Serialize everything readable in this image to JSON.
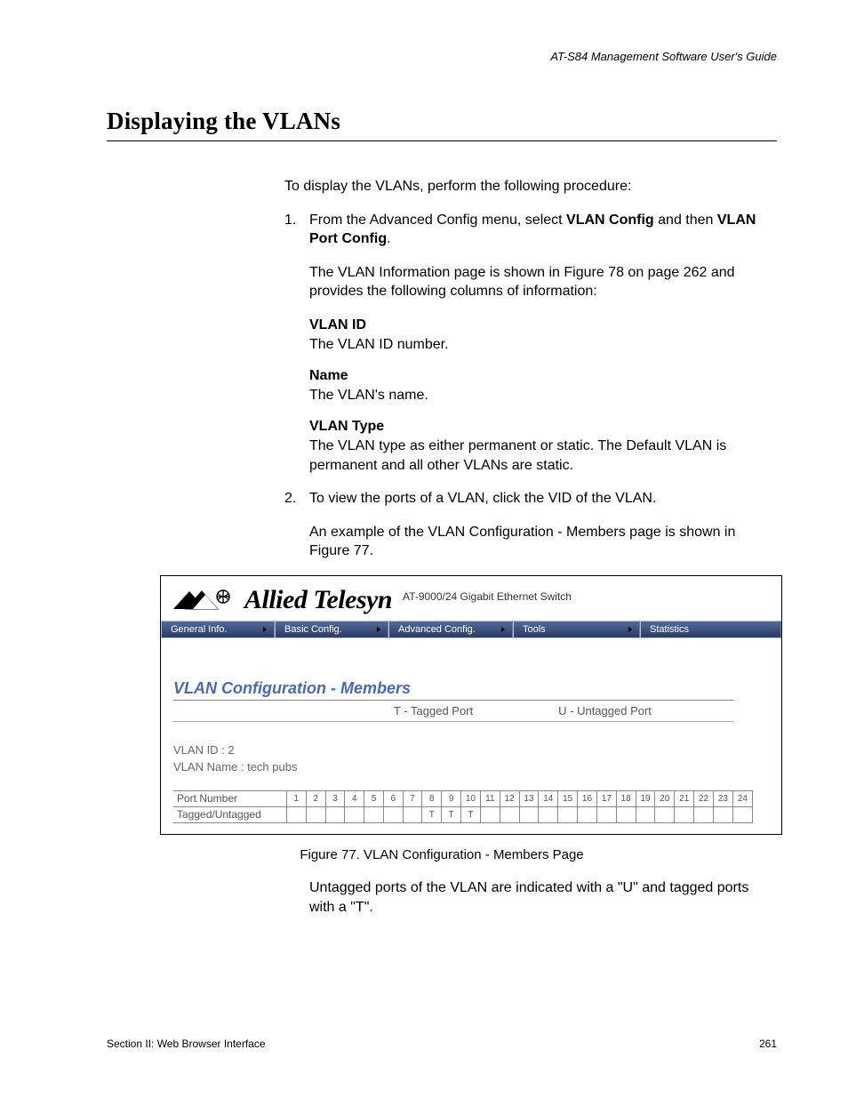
{
  "header": {
    "guide": "AT-S84 Management Software User's Guide"
  },
  "title": "Displaying the VLANs",
  "intro": "To display the VLANs, perform the following procedure:",
  "steps": {
    "s1num": "1.",
    "s1a": "From the Advanced Config menu, select ",
    "s1b": "VLAN Config",
    "s1c": " and then ",
    "s1d": "VLAN Port Config",
    "s1e": ".",
    "s1follow": "The VLAN Information page is shown in Figure 78 on page 262 and provides the following columns of information:",
    "defs": {
      "t1": "VLAN ID",
      "d1": "The VLAN ID number.",
      "t2": "Name",
      "d2": "The VLAN's name.",
      "t3": "VLAN Type",
      "d3": "The VLAN type as either permanent or static. The Default VLAN is permanent and all other VLANs are static."
    },
    "s2num": "2.",
    "s2": "To view the ports of a VLAN, click the VID of the VLAN.",
    "s2follow": "An example of the VLAN Configuration - Members page is shown in Figure 77."
  },
  "screenshot": {
    "brand": "Allied Telesyn",
    "model": "AT-9000/24 Gigabit Ethernet Switch",
    "menu": {
      "m1": "General Info.",
      "m2": "Basic Config.",
      "m3": "Advanced Config.",
      "m4": "Tools",
      "m5": "Statistics"
    },
    "page_title": "VLAN Configuration - Members",
    "legend_t": "T - Tagged Port",
    "legend_u": "U - Untagged Port",
    "vlan_id_label": "VLAN ID : 2",
    "vlan_name_label": "VLAN Name : tech pubs",
    "row_port_label": "Port Number",
    "row_tag_label": "Tagged/Untagged",
    "ports": [
      "1",
      "2",
      "3",
      "4",
      "5",
      "6",
      "7",
      "8",
      "9",
      "10",
      "11",
      "12",
      "13",
      "14",
      "15",
      "16",
      "17",
      "18",
      "19",
      "20",
      "21",
      "22",
      "23",
      "24"
    ],
    "tags": [
      "",
      "",
      "",
      "",
      "",
      "",
      "",
      "T",
      "T",
      "T",
      "",
      "",
      "",
      "",
      "",
      "",
      "",
      "",
      "",
      "",
      "",
      "",
      "",
      ""
    ]
  },
  "figure_caption": "Figure 77. VLAN Configuration - Members Page",
  "after_fig": "Untagged ports of the VLAN are indicated with a \"U\" and tagged ports with a \"T\".",
  "footer": {
    "left": "Section II: Web Browser Interface",
    "right": "261"
  }
}
